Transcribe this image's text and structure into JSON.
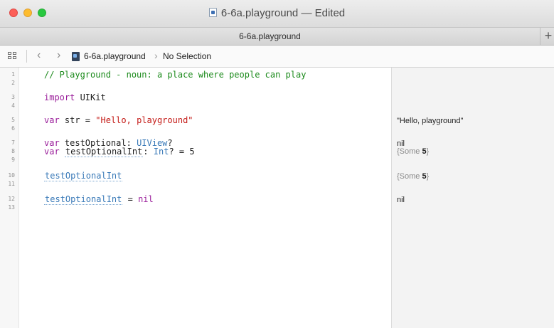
{
  "window": {
    "title": "6-6a.playground — Edited"
  },
  "tabs": [
    {
      "label": "6-6a.playground"
    }
  ],
  "tab_add_label": "+",
  "jumpbar": {
    "back": "‹",
    "forward": "›",
    "file": "6-6a.playground",
    "separator": "›",
    "selection": "No Selection"
  },
  "editor": {
    "line_numbers": [
      "1",
      "2",
      "3",
      "4",
      "5",
      "6",
      "7",
      "8",
      "9",
      "10",
      "11",
      "12",
      "13"
    ],
    "lines": {
      "l1": "// Playground - noun: a place where people can play",
      "l3_kw": "import",
      "l3_rest": " UIKit",
      "l5_kw": "var",
      "l5_mid": " str = ",
      "l5_str": "\"Hello, playground\"",
      "l7_kw": "var",
      "l7_mid": " testOptional: ",
      "l7_type": "UIView",
      "l7_end": "?",
      "l8_kw": "var",
      "l8_sp": " ",
      "l8_ident": "testOptionalInt",
      "l8_colon": ": ",
      "l8_type": "Int",
      "l8_rest": "? = 5",
      "l10_ident": "testOptionalInt",
      "l12_ident": "testOptionalInt",
      "l12_eq": " = ",
      "l12_nil": "nil"
    }
  },
  "results": {
    "r5": "\"Hello, playground\"",
    "r7": "nil",
    "r8_prefix": "{Some ",
    "r8_value": "5",
    "r8_suffix": "}",
    "r10_prefix": "{Some ",
    "r10_value": "5",
    "r10_suffix": "}",
    "r12": "nil"
  },
  "colors": {
    "comment": "#1b8a1b",
    "keyword": "#9b1f9b",
    "string": "#c41a16",
    "type": "#3a7ab8"
  },
  "icons": [
    "close-button",
    "minimize-button",
    "zoom-button",
    "document-icon",
    "grid-icon",
    "back-chevron-icon",
    "forward-chevron-icon",
    "playground-file-icon"
  ]
}
